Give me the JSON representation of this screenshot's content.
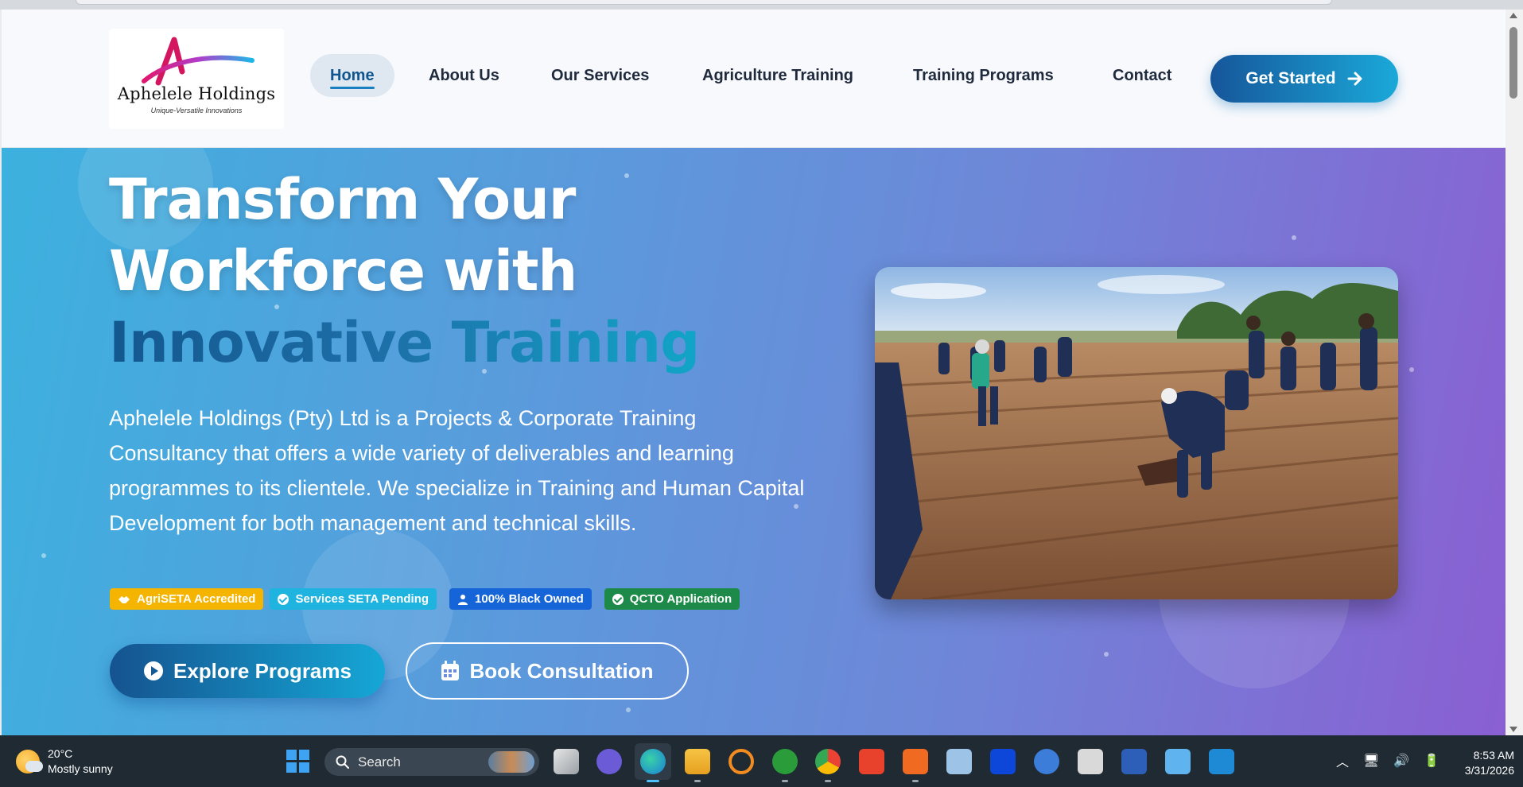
{
  "site": {
    "logo": {
      "name": "Aphelele Holdings",
      "tagline": "Unique-Versatile Innovations"
    },
    "nav": [
      {
        "label": "Home",
        "active": true
      },
      {
        "label": "About Us"
      },
      {
        "label": "Our Services"
      },
      {
        "label": "Agriculture Training"
      },
      {
        "label": "Training Programs"
      },
      {
        "label": "Contact"
      }
    ],
    "cta": {
      "label": "Get Started"
    }
  },
  "hero": {
    "title_line1": "Transform Your",
    "title_line2": "Workforce with",
    "title_highlight": "Innovative Training",
    "description": "Aphelele Holdings (Pty) Ltd is a Projects & Corporate Training Consultancy that offers a wide variety of deliverables and learning programmes to its clientele. We specialize in Training and Human Capital Development for both management and technical skills.",
    "badges": [
      {
        "label": "AgriSETA Accredited",
        "color": "#f4b400"
      },
      {
        "label": "Services SETA Pending",
        "color": "#1fb3e0"
      },
      {
        "label": "100% Black Owned",
        "color": "#1565d8"
      },
      {
        "label": "QCTO Application",
        "color": "#1e8a4a"
      }
    ],
    "primary_button": "Explore Programs",
    "secondary_button": "Book Consultation"
  },
  "taskbar": {
    "weather": {
      "temp": "20°C",
      "condition": "Mostly sunny"
    },
    "search_placeholder": "Search",
    "time": "8:53 AM",
    "date": "3/31/2026"
  },
  "colors": {
    "brand_blue": "#16569a",
    "brand_cyan": "#1aa9d9",
    "hero_start": "#3cb1de",
    "hero_end": "#8a5fd2"
  }
}
